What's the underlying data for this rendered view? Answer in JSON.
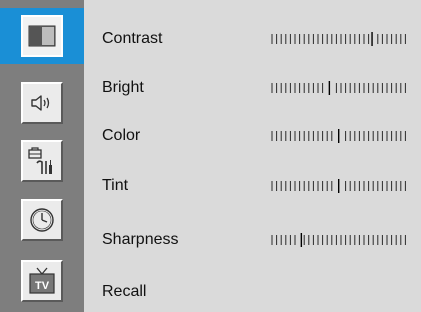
{
  "sidebar": {
    "tabs": [
      {
        "icon": "picture-icon",
        "selected": true
      },
      {
        "icon": "speaker-icon",
        "selected": false
      },
      {
        "icon": "tools-icon",
        "selected": false
      },
      {
        "icon": "clock-icon",
        "selected": false
      },
      {
        "icon": "tv-icon",
        "selected": false,
        "text": "TV"
      }
    ]
  },
  "menu": {
    "items": [
      {
        "label": "Contrast",
        "value": 0.75
      },
      {
        "label": "Bright",
        "value": 0.43
      },
      {
        "label": "Color",
        "value": 0.5
      },
      {
        "label": "Tint",
        "value": 0.5
      },
      {
        "label": "Sharpness",
        "value": 0.22
      },
      {
        "label": "Recall"
      }
    ]
  },
  "colors": {
    "selected_tab": "#1a8fd6",
    "panel": "#dadada",
    "sidebar": "#7e7e7e"
  }
}
